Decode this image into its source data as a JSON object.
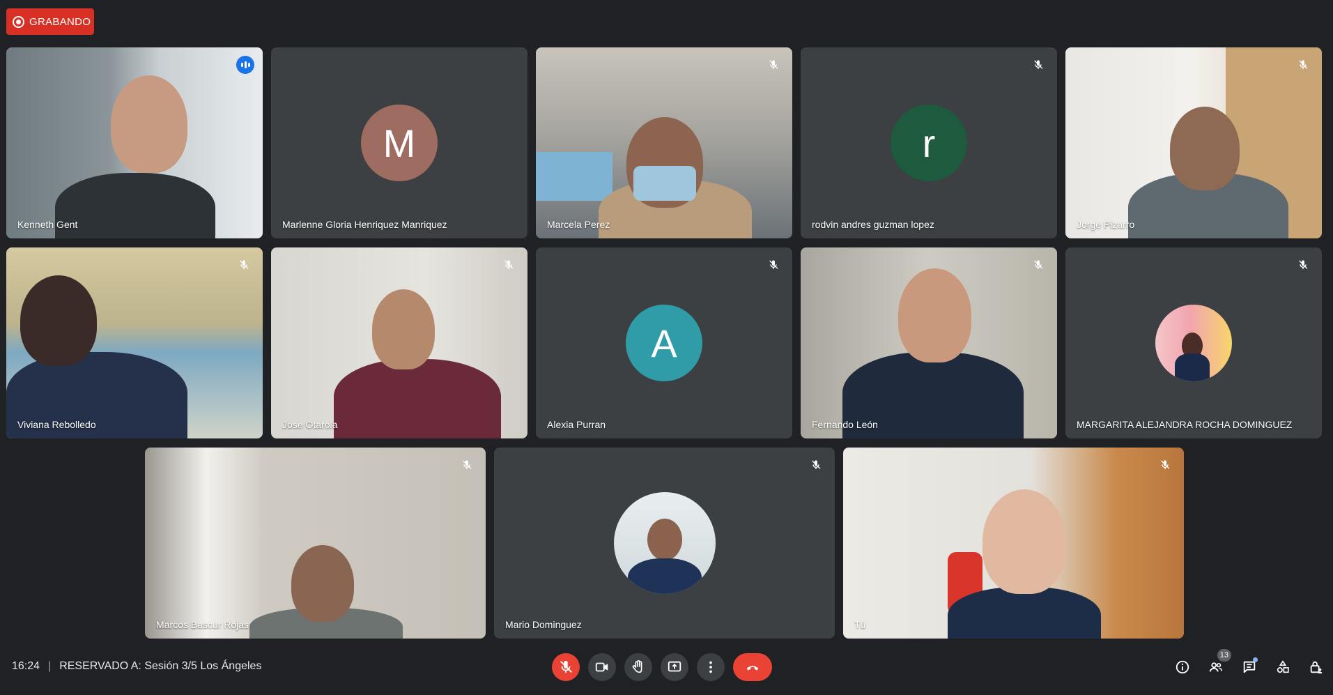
{
  "recording": {
    "label": "GRABANDO"
  },
  "participants": [
    {
      "name": "Kenneth Gent"
    },
    {
      "name": "Marlenne Gloria Henriquez Manriquez",
      "initial": "M",
      "color": "#9e6c61"
    },
    {
      "name": "Marcela Perez"
    },
    {
      "name": "rodvin andres guzman lopez",
      "initial": "r",
      "color": "#1e5a3d"
    },
    {
      "name": "Jorge Pizarro"
    },
    {
      "name": "Viviana Rebolledo"
    },
    {
      "name": "Jose Otarola"
    },
    {
      "name": "Alexia Purran",
      "initial": "A",
      "color": "#2f9ca8"
    },
    {
      "name": "Fernando León"
    },
    {
      "name": "MARGARITA ALEJANDRA ROCHA DOMINGUEZ"
    },
    {
      "name": "Marcos Bascur Rojas"
    },
    {
      "name": "Mario Dominguez"
    },
    {
      "name": "Tú"
    }
  ],
  "meeting": {
    "time": "16:24",
    "separator": "|",
    "title": "RESERVADO A: Sesión 3/5 Los Ángeles"
  },
  "people_count": "13",
  "colors": {
    "accent": "#8ab4f8",
    "danger": "#ea4335",
    "tile": "#3c4043",
    "background": "#202124"
  }
}
